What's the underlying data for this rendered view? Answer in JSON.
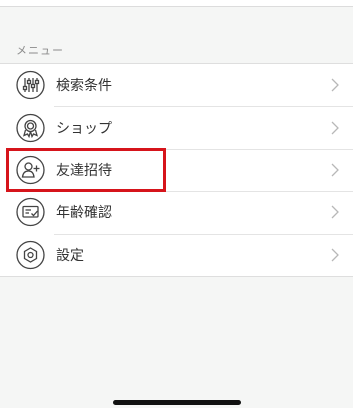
{
  "section": {
    "title": "メニュー"
  },
  "menu": {
    "items": [
      {
        "label": "検索条件",
        "icon": "sliders-icon"
      },
      {
        "label": "ショップ",
        "icon": "badge-icon"
      },
      {
        "label": "友達招待",
        "icon": "add-friend-icon"
      },
      {
        "label": "年齢確認",
        "icon": "id-card-check-icon"
      },
      {
        "label": "設定",
        "icon": "settings-hexagon-icon"
      }
    ]
  },
  "highlight": {
    "target": "友達招待",
    "color": "#d6141b"
  }
}
